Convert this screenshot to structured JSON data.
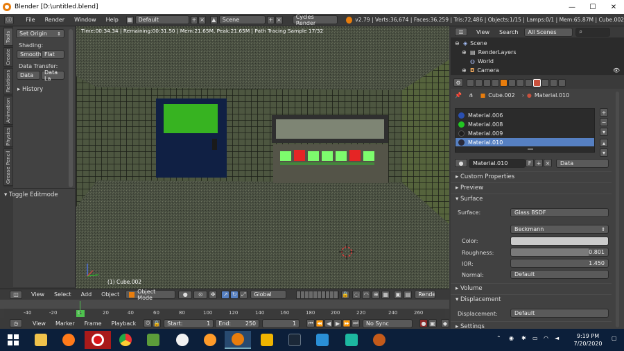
{
  "window": {
    "title": "Blender [D:\\untitled.blend]",
    "minimize": "—",
    "maximize": "☐",
    "close": "✕"
  },
  "infobar": {
    "menus": [
      "File",
      "Render",
      "Window",
      "Help"
    ],
    "screen_layout": "Default",
    "scene": "Scene",
    "render_engine": "Cycles Render",
    "stats": "v2.79 | Verts:36,674 | Faces:36,259 | Tris:72,486 | Objects:1/15 | Lamps:0/1 | Mem:65.87M | Cube.002"
  },
  "toolshelf": {
    "tabs": [
      "Tools",
      "Create",
      "Relations",
      "Animation",
      "Physics",
      "Grease Pencil"
    ],
    "set_origin": "Set Origin",
    "shading_label": "Shading:",
    "smooth": "Smooth",
    "flat": "Flat",
    "data_transfer_label": "Data Transfer:",
    "data": "Data",
    "data_layers": "Data La",
    "history": "History",
    "toggle_editmode": "Toggle Editmode"
  },
  "viewport": {
    "status": "Time:00:34.34 | Remaining:00:31.50 | Mem:21.65M, Peak:21.65M | Path Tracing Sample 17/32",
    "object_name": "(1) Cube.002"
  },
  "viewport_header": {
    "menus": [
      "View",
      "Select",
      "Add",
      "Object"
    ],
    "mode": "Object Mode",
    "orientation": "Global",
    "render_label": "RenderL"
  },
  "timeline": {
    "ticks": [
      "-40",
      "-20",
      "0",
      "20",
      "40",
      "60",
      "80",
      "100",
      "120",
      "140",
      "160",
      "180",
      "200",
      "220",
      "240",
      "260"
    ],
    "current_frame": "1",
    "menus": [
      "View",
      "Marker",
      "Frame",
      "Playback"
    ],
    "start_label": "Start:",
    "start": "1",
    "end_label": "End:",
    "end": "250",
    "sync": "No Sync"
  },
  "outliner": {
    "menus": [
      "View",
      "Search"
    ],
    "filter": "All Scenes",
    "items": [
      "Scene",
      "RenderLayers",
      "World",
      "Camera"
    ]
  },
  "properties": {
    "breadcrumb_object": "Cube.002",
    "breadcrumb_material": "Material.010",
    "materials": [
      {
        "name": "Material.006",
        "color": "#2a4fb0"
      },
      {
        "name": "Material.008",
        "color": "#22c522"
      },
      {
        "name": "Material.009",
        "color": "#1e1e1e"
      },
      {
        "name": "Material.010",
        "color": "#2a2a3a"
      }
    ],
    "selected_material": "Material.010",
    "slot_type_f": "F",
    "link": "Data",
    "panels": {
      "custom_properties": "Custom Properties",
      "preview": "Preview",
      "surface": "Surface",
      "volume": "Volume",
      "displacement": "Displacement",
      "settings": "Settings"
    },
    "surface_label": "Surface:",
    "surface_value": "Glass BSDF",
    "distribution": "Beckmann",
    "color_label": "Color:",
    "roughness_label": "Roughness:",
    "roughness": "0.801",
    "ior_label": "IOR:",
    "ior": "1.450",
    "normal_label": "Normal:",
    "normal_value": "Default",
    "displacement_label": "Displacement:",
    "displacement_value": "Default"
  },
  "taskbar": {
    "time": "9:19 PM",
    "date": "7/20/2020"
  },
  "colors": {
    "accent_orange": "#e87d0d",
    "selection_blue": "#5680c2",
    "taskbar": "#0c1f3a"
  }
}
